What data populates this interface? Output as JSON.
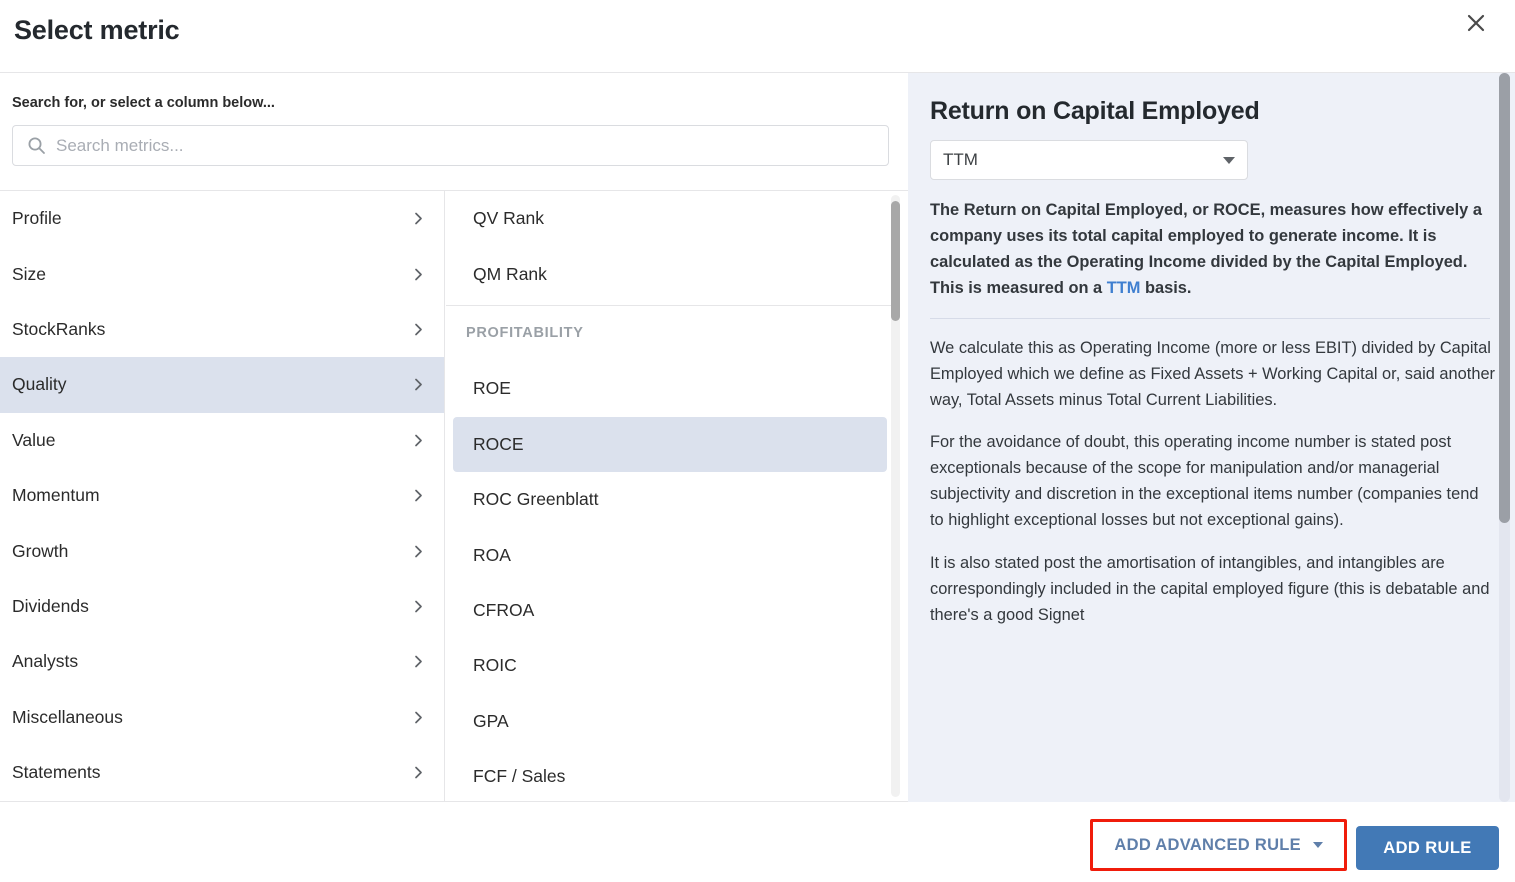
{
  "header": {
    "title": "Select metric",
    "close_icon": "close-icon"
  },
  "search": {
    "label": "Search for, or select a column below...",
    "placeholder": "Search metrics...",
    "value": "",
    "icon": "search-icon"
  },
  "categories": {
    "items": [
      {
        "label": "Profile",
        "selected": false
      },
      {
        "label": "Size",
        "selected": false
      },
      {
        "label": "StockRanks",
        "selected": false
      },
      {
        "label": "Quality",
        "selected": true
      },
      {
        "label": "Value",
        "selected": false
      },
      {
        "label": "Momentum",
        "selected": false
      },
      {
        "label": "Growth",
        "selected": false
      },
      {
        "label": "Dividends",
        "selected": false
      },
      {
        "label": "Analysts",
        "selected": false
      },
      {
        "label": "Miscellaneous",
        "selected": false
      },
      {
        "label": "Statements",
        "selected": false
      }
    ]
  },
  "metrics": {
    "items": [
      {
        "label": "QV Rank",
        "type": "item",
        "selected": false
      },
      {
        "label": "QM Rank",
        "type": "item",
        "selected": false
      },
      {
        "label": "PROFITABILITY",
        "type": "heading",
        "selected": false
      },
      {
        "label": "ROE",
        "type": "item",
        "selected": false
      },
      {
        "label": "ROCE",
        "type": "item",
        "selected": true
      },
      {
        "label": "ROC Greenblatt",
        "type": "item",
        "selected": false
      },
      {
        "label": "ROA",
        "type": "item",
        "selected": false
      },
      {
        "label": "CFROA",
        "type": "item",
        "selected": false
      },
      {
        "label": "ROIC",
        "type": "item",
        "selected": false
      },
      {
        "label": "GPA",
        "type": "item",
        "selected": false
      },
      {
        "label": "FCF / Sales",
        "type": "item",
        "selected": false
      }
    ]
  },
  "detail": {
    "title": "Return on Capital Employed",
    "period_value": "TTM",
    "lead_part1": "The Return on Capital Employed, or ROCE, measures how effectively a company uses its total capital employed to generate income. It is calculated as the Operating Income divided by the Capital Employed. This is measured on a ",
    "lead_link": "TTM",
    "lead_part2": " basis.",
    "paragraphs": [
      "We calculate this as Operating Income (more or less EBIT) divided by Capital Employed which we define as Fixed Assets + Working Capital or, said another way, Total Assets minus Total Current Liabilities.",
      "For the avoidance of doubt, this operating income number is stated post exceptionals because of the scope for manipulation and/or managerial subjectivity and discretion in the exceptional items number (companies tend to highlight exceptional losses but not exceptional gains).",
      "It is also stated post the amortisation of intangibles, and intangibles are correspondingly included in the capital employed figure (this is debatable and there's a good Signet"
    ]
  },
  "footer": {
    "advanced_rule_label": "ADD ADVANCED RULE",
    "add_rule_label": "ADD RULE"
  },
  "colors": {
    "selection": "#dbe1ed",
    "panel_bg": "#eef1f8",
    "primary_button": "#4279b6",
    "link": "#3f7fd0",
    "highlight_outline": "#f01c0b"
  }
}
